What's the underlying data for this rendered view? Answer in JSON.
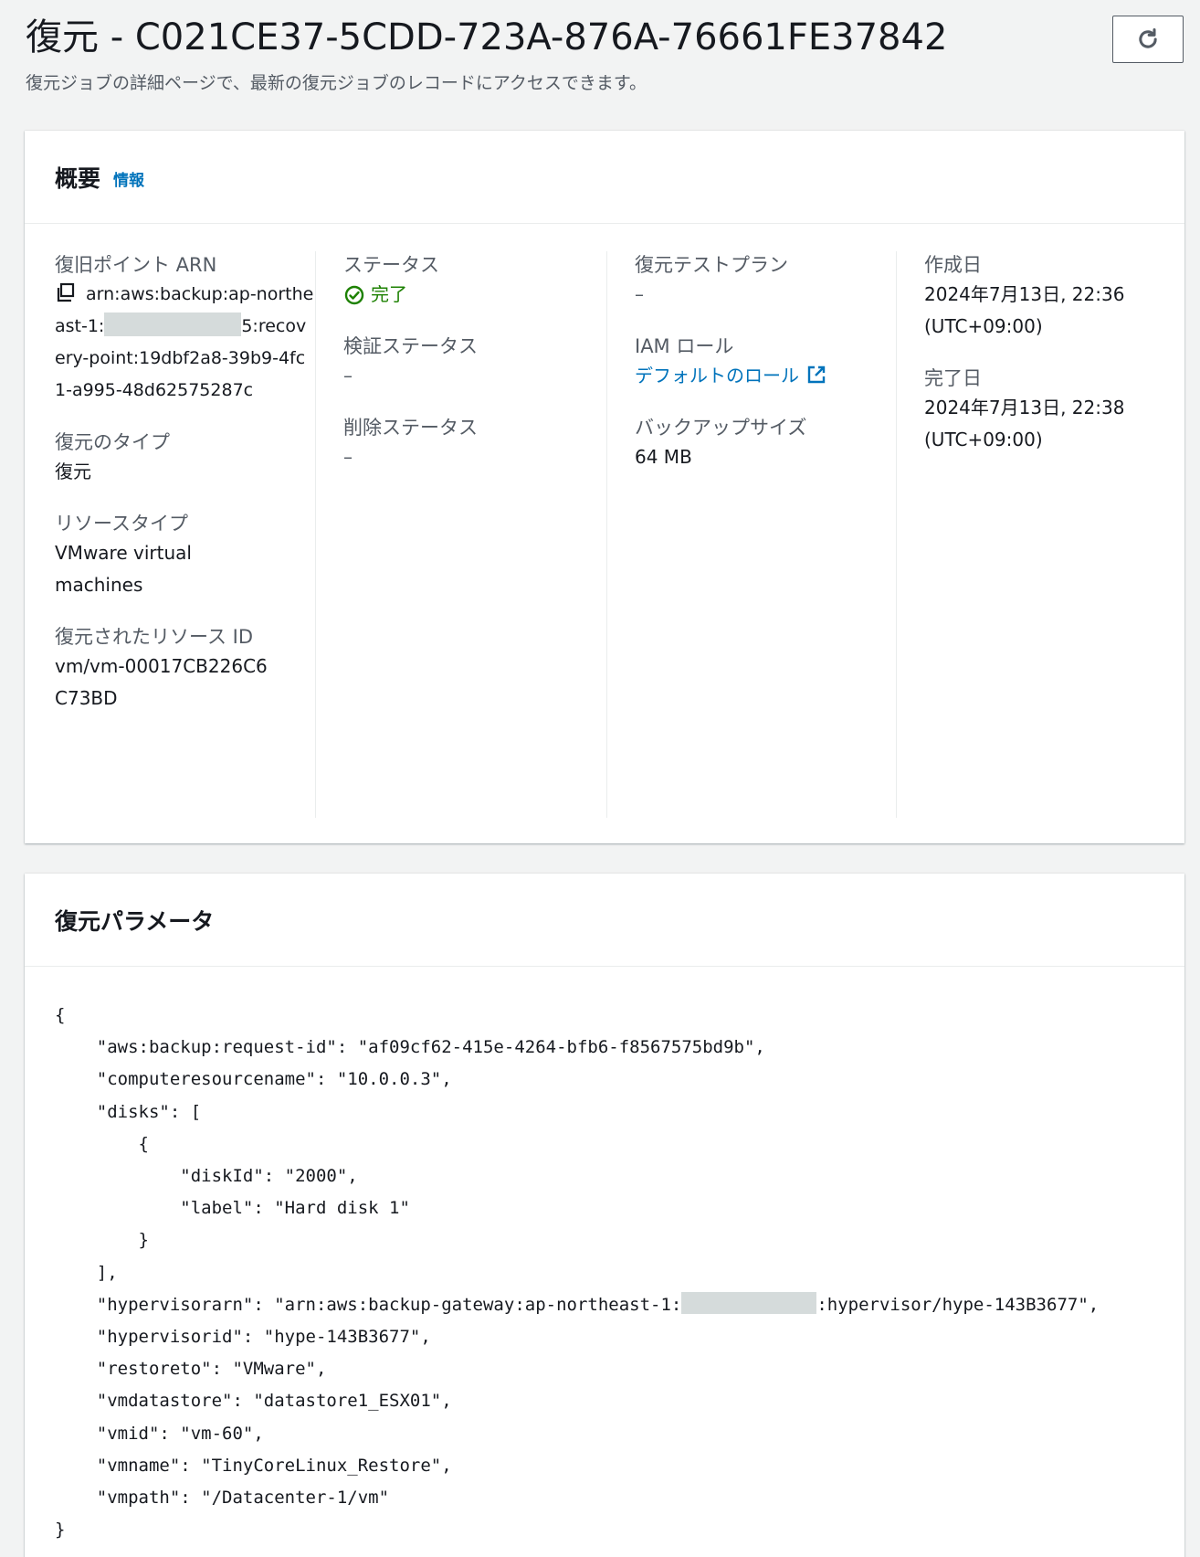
{
  "header": {
    "title": "復元 - C021CE37-5CDD-723A-876A-76661FE37842",
    "description": "復元ジョブの詳細ページで、最新の復元ジョブのレコードにアクセスできます。",
    "refresh_icon": "refresh-icon"
  },
  "overview": {
    "title": "概要",
    "info_link": "情報",
    "recovery_point_arn_label": "復旧ポイント ARN",
    "recovery_point_arn_prefix": "arn:aws:backup:ap-northeast-1:",
    "recovery_point_arn_suffix": "5:recovery-point:19dbf2a8-39b9-4fc1-a995-48d62575287c",
    "restore_type_label": "復元のタイプ",
    "restore_type_value": "復元",
    "resource_type_label": "リソースタイプ",
    "resource_type_value": "VMware virtual machines",
    "restored_resource_id_label": "復元されたリソース ID",
    "restored_resource_id_value": "vm/vm-00017CB226C6C73BD",
    "status_label": "ステータス",
    "status_value": "完了",
    "validation_status_label": "検証ステータス",
    "validation_status_value": "–",
    "deletion_status_label": "削除ステータス",
    "deletion_status_value": "–",
    "restore_test_plan_label": "復元テストプラン",
    "restore_test_plan_value": "–",
    "iam_role_label": "IAM ロール",
    "iam_role_value": "デフォルトのロール",
    "backup_size_label": "バックアップサイズ",
    "backup_size_value": "64 MB",
    "created_label": "作成日",
    "created_value": "2024年7月13日, 22:36 (UTC+09:00)",
    "completed_label": "完了日",
    "completed_value": "2024年7月13日, 22:38 (UTC+09:00)"
  },
  "params": {
    "title": "復元パラメータ",
    "lines": [
      "{",
      "    \"aws:backup:request-id\": \"af09cf62-415e-4264-bfb6-f8567575bd9b\",",
      "    \"computeresourcename\": \"10.0.0.3\",",
      "    \"disks\": [",
      "        {",
      "            \"diskId\": \"2000\",",
      "            \"label\": \"Hard disk 1\"",
      "        }",
      "    ],",
      "    \"hypervisorarn\": \"arn:aws:backup-gateway:ap-northeast-1:",
      "    \"hypervisorid\": \"hype-143B3677\",",
      "    \"restoreto\": \"VMware\",",
      "    \"vmdatastore\": \"datastore1_ESX01\",",
      "    \"vmid\": \"vm-60\",",
      "    \"vmname\": \"TinyCoreLinux_Restore\",",
      "    \"vmpath\": \"/Datacenter-1/vm\"",
      "}"
    ],
    "hypervisorarn_tail": ":hypervisor/hype-143B3677\","
  }
}
